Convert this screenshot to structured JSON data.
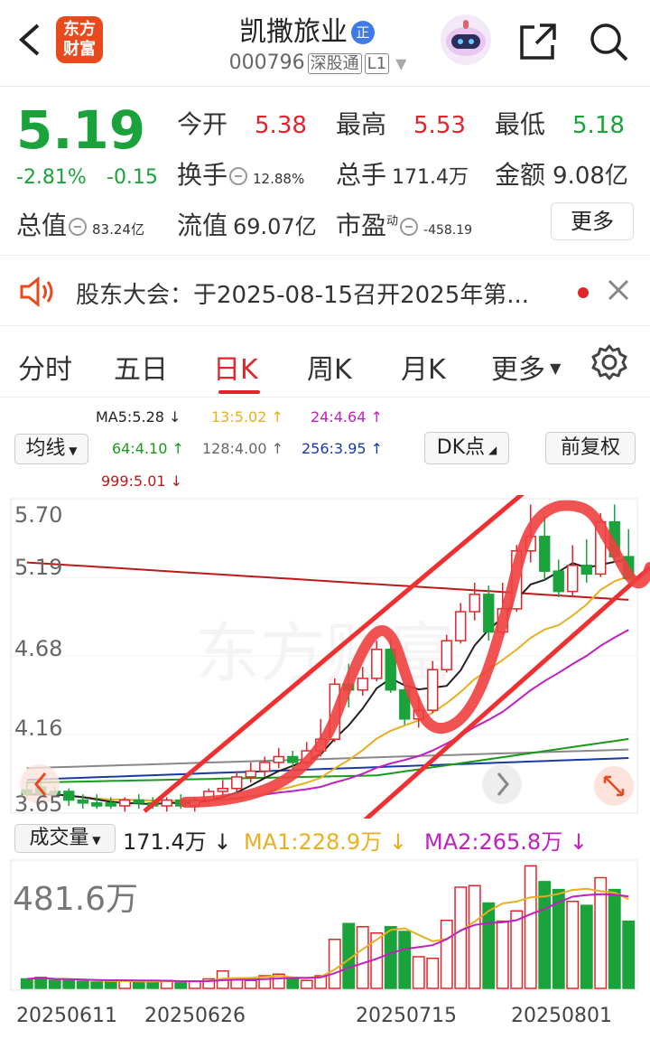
{
  "header": {
    "title": "凯撒旅业",
    "badge": "正",
    "code": "000796",
    "market": "深股通",
    "level": "L1",
    "logo_text": "东方财富"
  },
  "quote": {
    "price": "5.19",
    "change_pct": "-2.81%",
    "change_amt": "-0.15",
    "open_label": "今开",
    "open": "5.38",
    "high_label": "最高",
    "high": "5.53",
    "low_label": "最低",
    "low": "5.18",
    "turnover_label": "换手",
    "turnover": "12.88%",
    "volume_label": "总手",
    "volume": "171.4万",
    "amount_label": "金额",
    "amount": "9.08亿",
    "mktcap_label": "总值",
    "mktcap": "83.24亿",
    "float_label": "流值",
    "float": "69.07亿",
    "pe_label": "市盈",
    "pe_sup": "动",
    "pe": "-458.19",
    "more": "更多"
  },
  "notice": {
    "text": "股东大会：于2025-08-15召开2025年第..."
  },
  "tabs": [
    "分时",
    "五日",
    "日K",
    "周K",
    "月K",
    "更多"
  ],
  "ma": {
    "ma5": "MA5:5.28",
    "m13": "13:5.02",
    "m24": "24:4.64",
    "m64": "64:4.10",
    "m128": "128:4.00",
    "m256": "256:3.95",
    "m999": "999:5.01"
  },
  "controls": {
    "avg_line": "均线",
    "dk": "DK点",
    "adjust": "前复权"
  },
  "y_axis": [
    "5.70",
    "5.19",
    "4.68",
    "4.16",
    "3.65"
  ],
  "volume_panel": {
    "label": "成交量",
    "value": "171.4万",
    "ma1": "MA1:228.9万",
    "ma2": "MA2:265.8万",
    "max": "481.6万"
  },
  "dates": [
    "20250611",
    "20250626",
    "20250715",
    "20250801"
  ],
  "watermark": "东方财富",
  "colors": {
    "up": "#e3242b",
    "down": "#1aa33a",
    "accent": "#e3242b"
  },
  "chart_data": {
    "type": "candlestick",
    "candles": [
      [
        3.73,
        3.79,
        3.7,
        3.68
      ],
      [
        3.75,
        3.78,
        3.7,
        3.73
      ],
      [
        3.72,
        3.75,
        3.7,
        3.68
      ],
      [
        3.72,
        3.74,
        3.66,
        3.62
      ],
      [
        3.66,
        3.7,
        3.64,
        3.6
      ],
      [
        3.64,
        3.7,
        3.62,
        3.6
      ],
      [
        3.64,
        3.68,
        3.62,
        3.6
      ],
      [
        3.62,
        3.68,
        3.66,
        3.58
      ],
      [
        3.66,
        3.7,
        3.64,
        3.6
      ],
      [
        3.64,
        3.68,
        3.62,
        3.6
      ],
      [
        3.62,
        3.68,
        3.66,
        3.58
      ],
      [
        3.66,
        3.7,
        3.62,
        3.6
      ],
      [
        3.62,
        3.68,
        3.66,
        3.58
      ],
      [
        3.66,
        3.74,
        3.72,
        3.64
      ],
      [
        3.72,
        3.8,
        3.74,
        3.68
      ],
      [
        3.74,
        3.86,
        3.82,
        3.72
      ],
      [
        3.82,
        3.92,
        3.86,
        3.78
      ],
      [
        3.86,
        3.96,
        3.92,
        3.82
      ],
      [
        3.92,
        4.02,
        3.96,
        3.88
      ],
      [
        3.96,
        4.0,
        3.92,
        3.86
      ],
      [
        3.92,
        4.06,
        4.0,
        3.9
      ],
      [
        4.0,
        4.22,
        4.08,
        3.96
      ],
      [
        4.08,
        4.5,
        4.46,
        4.06
      ],
      [
        4.46,
        4.6,
        4.42,
        4.3
      ],
      [
        4.42,
        4.58,
        4.5,
        4.38
      ],
      [
        4.5,
        4.76,
        4.7,
        4.48
      ],
      [
        4.7,
        4.78,
        4.42,
        4.4
      ],
      [
        4.42,
        4.46,
        4.22,
        4.18
      ],
      [
        4.22,
        4.38,
        4.28,
        4.16
      ],
      [
        4.28,
        4.62,
        4.56,
        4.26
      ],
      [
        4.56,
        4.8,
        4.76,
        4.54
      ],
      [
        4.76,
        5.02,
        4.96,
        4.74
      ],
      [
        4.96,
        5.16,
        5.08,
        4.9
      ],
      [
        5.08,
        5.14,
        4.82,
        4.76
      ],
      [
        4.82,
        5.16,
        4.98,
        4.8
      ],
      [
        4.98,
        5.42,
        5.38,
        4.96
      ],
      [
        5.38,
        5.7,
        5.48,
        5.3
      ],
      [
        5.48,
        5.62,
        5.24,
        5.18
      ],
      [
        5.24,
        5.32,
        5.1,
        5.06
      ],
      [
        5.1,
        5.42,
        5.28,
        5.06
      ],
      [
        5.28,
        5.46,
        5.22,
        5.16
      ],
      [
        5.22,
        5.64,
        5.58,
        5.2
      ],
      [
        5.58,
        5.7,
        5.34,
        5.3
      ],
      [
        5.34,
        5.53,
        5.19,
        5.18
      ]
    ],
    "volumes": [
      12,
      14,
      10,
      11,
      9,
      8,
      8,
      10,
      9,
      8,
      10,
      8,
      9,
      12,
      22,
      13,
      10,
      16,
      18,
      13,
      10,
      16,
      62,
      82,
      78,
      70,
      78,
      72,
      40,
      38,
      86,
      128,
      130,
      108,
      85,
      98,
      155,
      135,
      125,
      110,
      105,
      140,
      125,
      85
    ]
  }
}
